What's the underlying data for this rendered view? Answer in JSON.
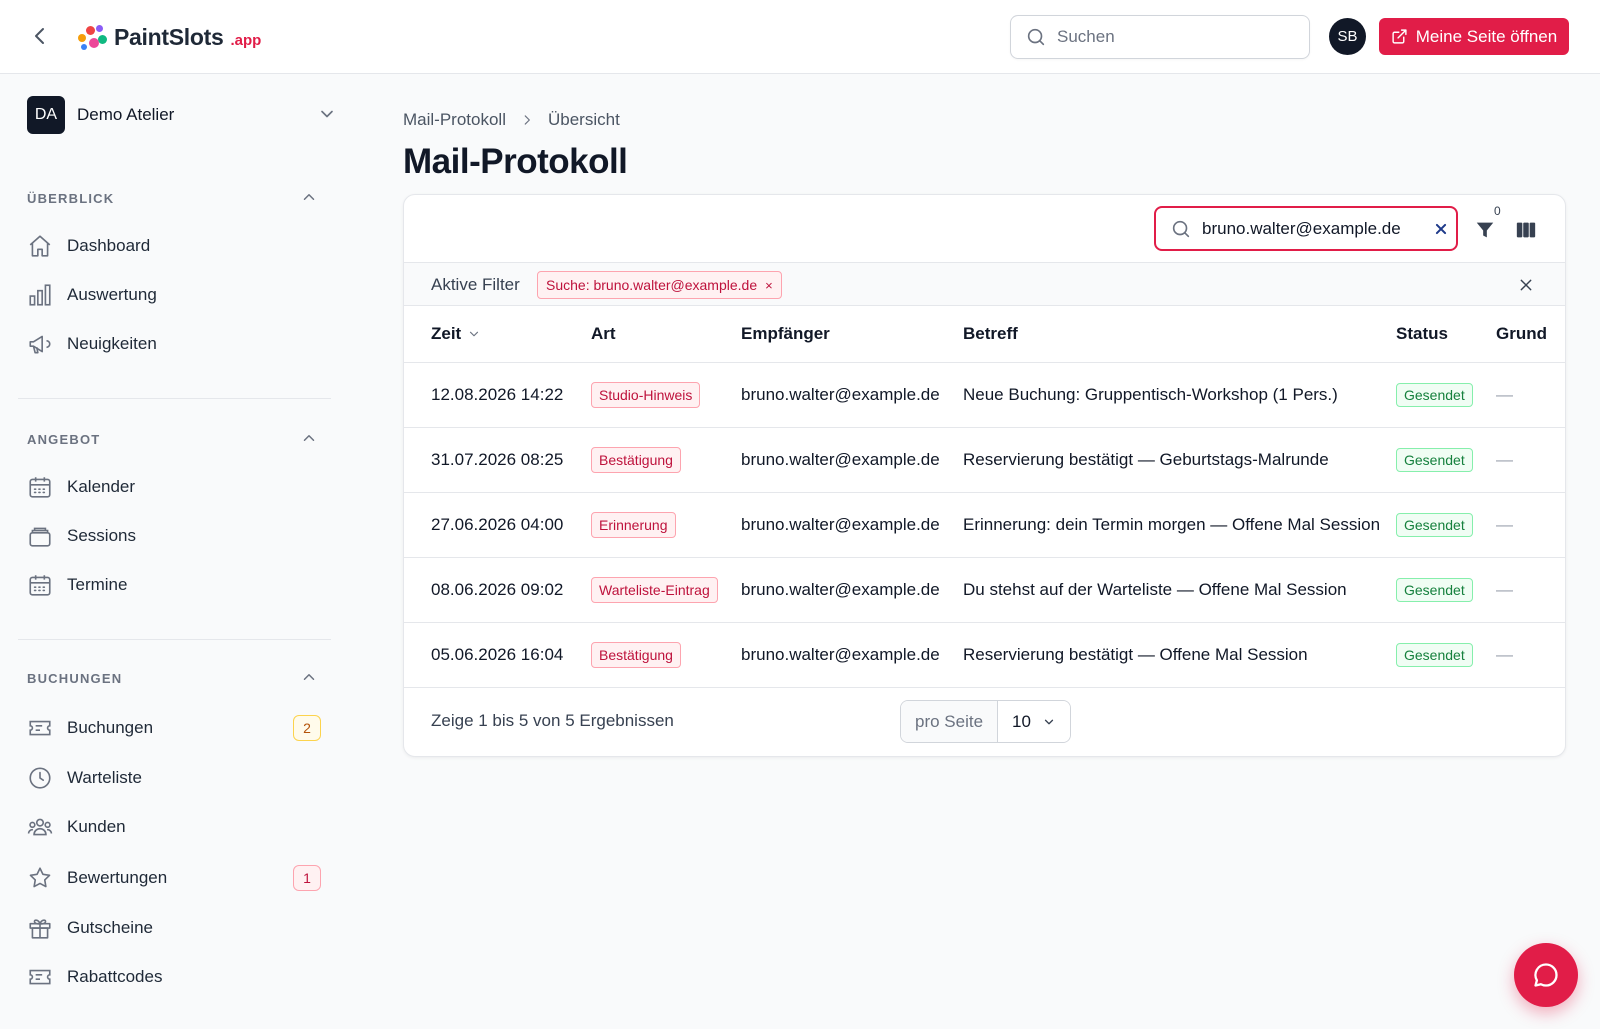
{
  "topbar": {
    "logo_text": "PaintSlots",
    "logo_suffix": ".app",
    "search_placeholder": "Suchen",
    "user_initials": "SB",
    "open_page_label": "Meine Seite öffnen"
  },
  "sidebar": {
    "workspace": {
      "initials": "DA",
      "name": "Demo Atelier"
    },
    "sections": [
      {
        "title": "ÜBERBLICK",
        "items": [
          {
            "label": "Dashboard"
          },
          {
            "label": "Auswertung"
          },
          {
            "label": "Neuigkeiten"
          }
        ]
      },
      {
        "title": "ANGEBOT",
        "items": [
          {
            "label": "Kalender"
          },
          {
            "label": "Sessions"
          },
          {
            "label": "Termine"
          }
        ]
      },
      {
        "title": "BUCHUNGEN",
        "items": [
          {
            "label": "Buchungen",
            "badge": "2"
          },
          {
            "label": "Warteliste"
          },
          {
            "label": "Kunden"
          },
          {
            "label": "Bewertungen",
            "badge": "1"
          },
          {
            "label": "Gutscheine"
          },
          {
            "label": "Rabattcodes"
          }
        ]
      }
    ]
  },
  "breadcrumb": {
    "parent": "Mail-Protokoll",
    "current": "Übersicht"
  },
  "page_title": "Mail-Protokoll",
  "table_toolbar": {
    "search_value": "bruno.walter@example.de",
    "filter_count": "0"
  },
  "active_filters": {
    "label": "Aktive Filter",
    "chip": "Suche: bruno.walter@example.de",
    "chip_remove": "×"
  },
  "table": {
    "columns": [
      "Zeit",
      "Art",
      "Empfänger",
      "Betreff",
      "Status",
      "Grund"
    ],
    "rows": [
      {
        "time": "12.08.2026 14:22",
        "type": "Studio-Hinweis",
        "recipient": "bruno.walter@example.de",
        "subject": "Neue Buchung: Gruppentisch-Workshop (1 Pers.)",
        "status": "Gesendet",
        "reason": "—"
      },
      {
        "time": "31.07.2026 08:25",
        "type": "Bestätigung",
        "recipient": "bruno.walter@example.de",
        "subject": "Reservierung bestätigt — Geburtstags-Malrunde",
        "status": "Gesendet",
        "reason": "—"
      },
      {
        "time": "27.06.2026 04:00",
        "type": "Erinnerung",
        "recipient": "bruno.walter@example.de",
        "subject": "Erinnerung: dein Termin morgen — Offene Mal Session",
        "status": "Gesendet",
        "reason": "—"
      },
      {
        "time": "08.06.2026 09:02",
        "type": "Warteliste-Eintrag",
        "recipient": "bruno.walter@example.de",
        "subject": "Du stehst auf der Warteliste — Offene Mal Session",
        "status": "Gesendet",
        "reason": "—"
      },
      {
        "time": "05.06.2026 16:04",
        "type": "Bestätigung",
        "recipient": "bruno.walter@example.de",
        "subject": "Reservierung bestätigt — Offene Mal Session",
        "status": "Gesendet",
        "reason": "—"
      }
    ]
  },
  "pagination": {
    "results_text": "Zeige 1 bis 5 von 5 Ergebnissen",
    "per_page_label": "pro Seite",
    "per_page_value": "10"
  },
  "colors": {
    "accent": "#e11d48",
    "status_ok": "#15803d"
  }
}
